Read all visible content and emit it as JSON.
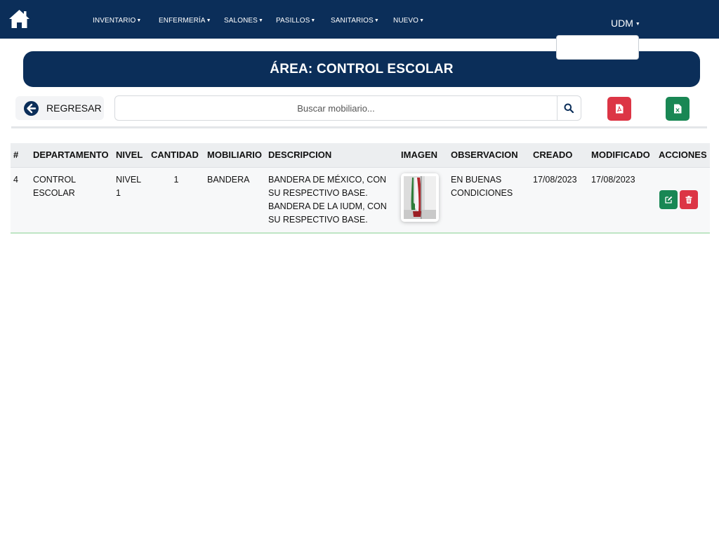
{
  "navbar": {
    "home_icon": "home-icon",
    "menu": [
      {
        "label": "INVENTARIO"
      },
      {
        "label": "ENFERMERÍA"
      },
      {
        "label": "SALONES"
      },
      {
        "label": "PASILLOS"
      },
      {
        "label": "SANITARIOS"
      },
      {
        "label": "NUEVO"
      }
    ],
    "user_menu_label": "UDM",
    "background": "#0b2e59"
  },
  "area": {
    "title": "ÁREA: CONTROL ESCOLAR"
  },
  "toolbar": {
    "back_label": "REGRESAR",
    "search_placeholder": "Buscar mobiliario...",
    "search_value": "",
    "pdf_icon": "file-pdf-icon",
    "excel_icon": "file-excel-icon",
    "pdf_color": "#dc3545",
    "excel_color": "#198754"
  },
  "table": {
    "headers": [
      "#",
      "DEPARTAMENTO",
      "NIVEL",
      "CANTIDAD",
      "MOBILIARIO",
      "DESCRIPCION",
      "IMAGEN",
      "OBSERVACION",
      "CREADO",
      "MODIFICADO",
      "ACCIONES"
    ],
    "rows": [
      {
        "id": "4",
        "departamento": "CONTROL ESCOLAR",
        "nivel": "NIVEL 1",
        "cantidad": "1",
        "mobiliario": "BANDERA",
        "descripcion": "BANDERA DE MÉXICO, CON SU RESPECTIVO BASE. BANDERA DE LA IUDM, CON SU RESPECTIVO BASE.",
        "imagen": "flag-photo",
        "observacion": "EN BUENAS CONDICIONES",
        "creado": "17/08/2023",
        "modificado": "17/08/2023",
        "actions": [
          "edit-icon",
          "trash-icon"
        ]
      }
    ]
  }
}
